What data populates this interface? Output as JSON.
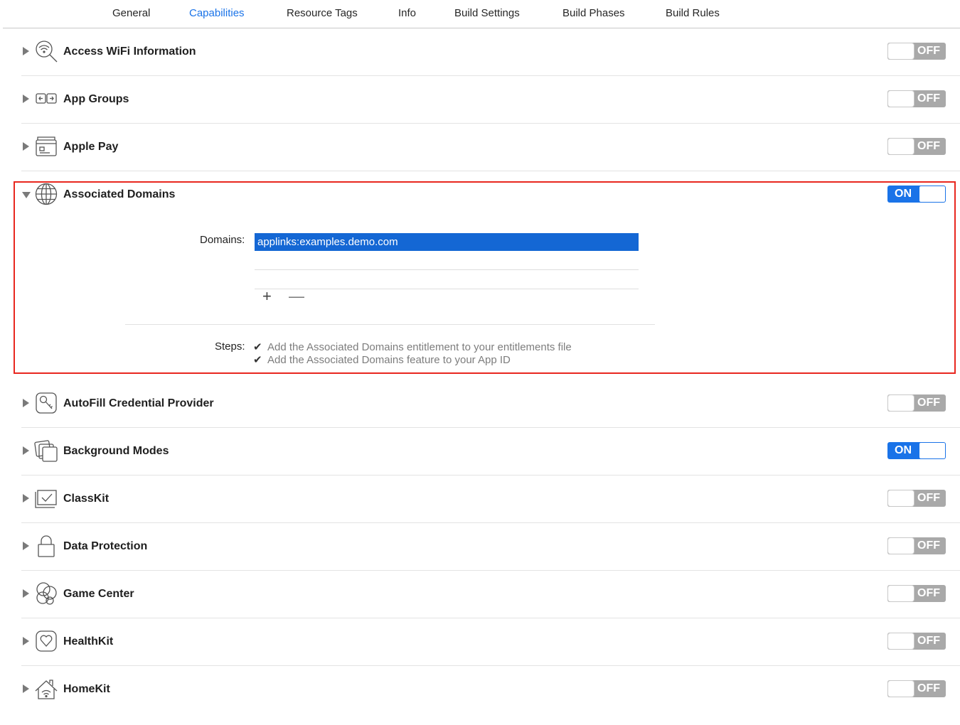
{
  "tabs": [
    {
      "label": "General",
      "active": false
    },
    {
      "label": "Capabilities",
      "active": true
    },
    {
      "label": "Resource Tags",
      "active": false
    },
    {
      "label": "Info",
      "active": false
    },
    {
      "label": "Build Settings",
      "active": false
    },
    {
      "label": "Build Phases",
      "active": false
    },
    {
      "label": "Build Rules",
      "active": false
    }
  ],
  "capabilities": [
    {
      "label": "Access WiFi Information",
      "icon": "wifi-search-icon",
      "state": "OFF"
    },
    {
      "label": "App Groups",
      "icon": "app-groups-icon",
      "state": "OFF"
    },
    {
      "label": "Apple Pay",
      "icon": "wallet-icon",
      "state": "OFF"
    },
    {
      "label": "Associated Domains",
      "icon": "globe-icon",
      "state": "ON"
    },
    {
      "label": "AutoFill Credential Provider",
      "icon": "key-icon",
      "state": "OFF"
    },
    {
      "label": "Background Modes",
      "icon": "layered-windows-icon",
      "state": "ON"
    },
    {
      "label": "ClassKit",
      "icon": "classkit-icon",
      "state": "OFF"
    },
    {
      "label": "Data Protection",
      "icon": "lock-icon",
      "state": "OFF"
    },
    {
      "label": "Game Center",
      "icon": "game-center-icon",
      "state": "OFF"
    },
    {
      "label": "HealthKit",
      "icon": "heart-icon",
      "state": "OFF"
    },
    {
      "label": "HomeKit",
      "icon": "home-icon",
      "state": "OFF"
    }
  ],
  "associated_domains": {
    "domains_label": "Domains:",
    "domains": [
      "applinks:examples.demo.com"
    ],
    "add_symbol": "+",
    "remove_symbol": "—",
    "steps_label": "Steps:",
    "check_symbol": "✔",
    "steps": [
      "Add the Associated Domains entitlement to your entitlements file",
      "Add the Associated Domains feature to your App ID"
    ]
  },
  "colors": {
    "accent": "#1a73e8",
    "selection": "#1467d4",
    "toggle_off": "#a9a9a9",
    "highlight_border": "#e8271f"
  }
}
